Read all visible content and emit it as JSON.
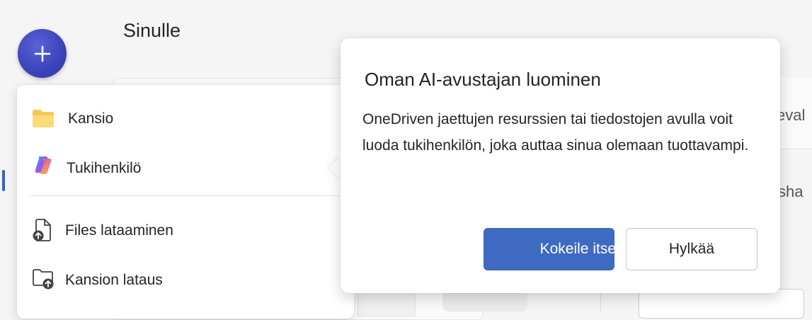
{
  "page": {
    "title": "Sinulle"
  },
  "new_button": {
    "icon": "plus-icon",
    "color": "#3a43b9"
  },
  "background": {
    "text_1": "eval",
    "text_2": "l sha"
  },
  "menu": {
    "items": [
      {
        "label": "Kansio",
        "icon": "folder-icon"
      },
      {
        "label": "Tukihenkilö",
        "icon": "copilot-icon"
      },
      {
        "label": "Files lataaminen",
        "icon": "file-upload-icon"
      },
      {
        "label": "Kansion lataus",
        "icon": "folder-upload-icon"
      }
    ]
  },
  "callout": {
    "title": "Oman AI-avustajan luominen",
    "body": "OneDriven jaettujen resurssien tai tiedostojen avulla voit luoda tukihenkilön, joka auttaa sinua olemaan tuottavampi.",
    "primary_label": "Kokeile itse",
    "secondary_label": "Hylkää",
    "accent": "#3e6bc1"
  }
}
